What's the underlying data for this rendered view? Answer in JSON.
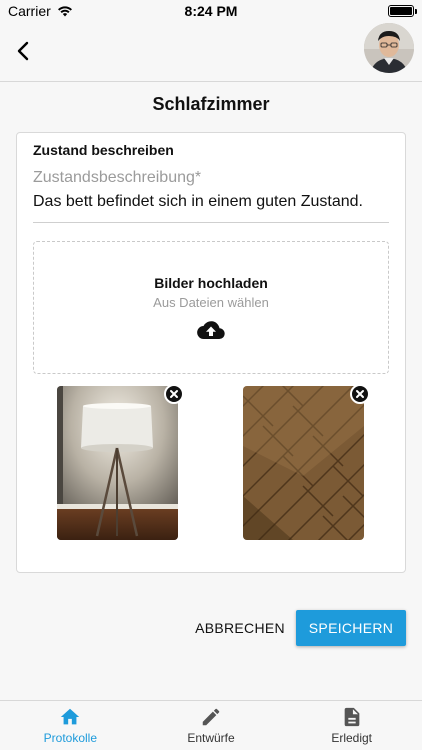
{
  "status_bar": {
    "carrier": "Carrier",
    "time": "8:24 PM"
  },
  "page": {
    "title": "Schlafzimmer"
  },
  "form": {
    "section_label": "Zustand beschreiben",
    "field": {
      "label": "Zustandsbeschreibung*",
      "value": "Das bett befindet sich in einem guten Zustand."
    },
    "upload": {
      "title": "Bilder hochladen",
      "subtitle": "Aus Dateien wählen",
      "icon": "cloud-upload-icon"
    },
    "photos": [
      {
        "subject": "floor lamp",
        "remove_icon": "close-icon"
      },
      {
        "subject": "wooden parquet floor",
        "remove_icon": "close-icon"
      }
    ]
  },
  "actions": {
    "cancel_label": "ABBRECHEN",
    "save_label": "SPEICHERN"
  },
  "tabs": [
    {
      "label": "Protokolle",
      "icon": "home-icon",
      "active": true
    },
    {
      "label": "Entwürfe",
      "icon": "pencil-icon",
      "active": false
    },
    {
      "label": "Erledigt",
      "icon": "document-icon",
      "active": false
    }
  ],
  "colors": {
    "accent": "#1e9bdb",
    "background": "#f7f7f7",
    "card": "#ffffff"
  }
}
